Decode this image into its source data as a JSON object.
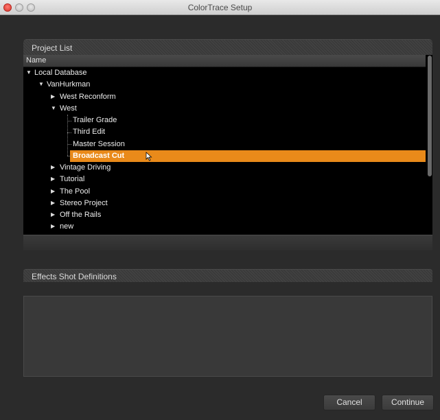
{
  "window": {
    "title": "ColorTrace Setup"
  },
  "project_list": {
    "header": "Project List",
    "column_name": "Name",
    "rows": [
      {
        "label": "Local Database",
        "depth": 0,
        "expander": "expanded"
      },
      {
        "label": "VanHurkman",
        "depth": 1,
        "expander": "expanded"
      },
      {
        "label": "West Reconform",
        "depth": 2,
        "expander": "collapsed"
      },
      {
        "label": "West",
        "depth": 2,
        "expander": "expanded"
      },
      {
        "label": "Trailer Grade",
        "depth": 3,
        "expander": "none"
      },
      {
        "label": "Third Edit",
        "depth": 3,
        "expander": "none"
      },
      {
        "label": "Master Session",
        "depth": 3,
        "expander": "none"
      },
      {
        "label": "Broadcast Cut",
        "depth": 3,
        "expander": "none",
        "selected": true
      },
      {
        "label": "Vintage Driving",
        "depth": 2,
        "expander": "collapsed"
      },
      {
        "label": "Tutorial",
        "depth": 2,
        "expander": "collapsed"
      },
      {
        "label": "The Pool",
        "depth": 2,
        "expander": "collapsed"
      },
      {
        "label": "Stereo Project",
        "depth": 2,
        "expander": "collapsed"
      },
      {
        "label": "Off the Rails",
        "depth": 2,
        "expander": "collapsed"
      },
      {
        "label": "new",
        "depth": 2,
        "expander": "collapsed"
      }
    ],
    "selection_color": "#e98a1a"
  },
  "effects": {
    "header": "Effects Shot Definitions"
  },
  "buttons": {
    "cancel": "Cancel",
    "continue": "Continue"
  }
}
